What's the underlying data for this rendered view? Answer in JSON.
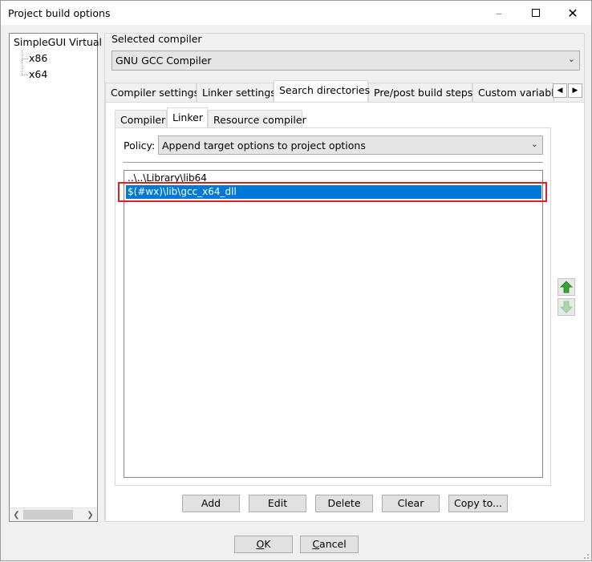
{
  "window": {
    "title": "Project build options"
  },
  "tree": {
    "root": "SimpleGUI Virtual",
    "children": [
      "x86",
      "x64"
    ]
  },
  "compiler": {
    "label": "Selected compiler",
    "value": "GNU GCC Compiler"
  },
  "main_tabs": [
    "Compiler settings",
    "Linker settings",
    "Search directories",
    "Pre/post build steps",
    "Custom variable"
  ],
  "sub_tabs": [
    "Compiler",
    "Linker",
    "Resource compiler"
  ],
  "policy": {
    "label": "Policy:",
    "value": "Append target options to project options"
  },
  "dirs": [
    "..\\..\\Library\\lib64",
    "$(#wx)\\lib\\gcc_x64_dll"
  ],
  "actions": {
    "add": "Add",
    "edit": "Edit",
    "delete": "Delete",
    "clear": "Clear",
    "copy": "Copy to..."
  },
  "dialog": {
    "ok_first": "O",
    "ok_rest": "K",
    "cancel_first": "C",
    "cancel_rest": "ancel"
  },
  "colors": {
    "selection": "#0078d7",
    "highlight": "#e02020",
    "arrow_up": "#2ea82e",
    "arrow_down": "#a8d8a8"
  },
  "icons": [
    "minimize-icon",
    "maximize-icon",
    "close-icon",
    "arrow-up-icon",
    "arrow-down-icon",
    "chevron-down-icon"
  ]
}
